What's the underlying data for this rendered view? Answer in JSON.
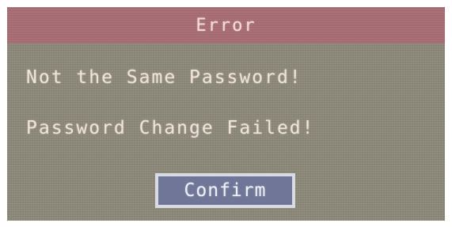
{
  "dialog": {
    "title": "Error",
    "messages": [
      "Not the Same Password!",
      "Password Change Failed!"
    ],
    "confirm_label": "Confirm"
  },
  "colors": {
    "title_bar": "#a86b72",
    "dialog_bg": "#8b8777",
    "button_bg": "#6f7697",
    "button_border": "#d8dbe2",
    "text": "#f1e3dc"
  }
}
